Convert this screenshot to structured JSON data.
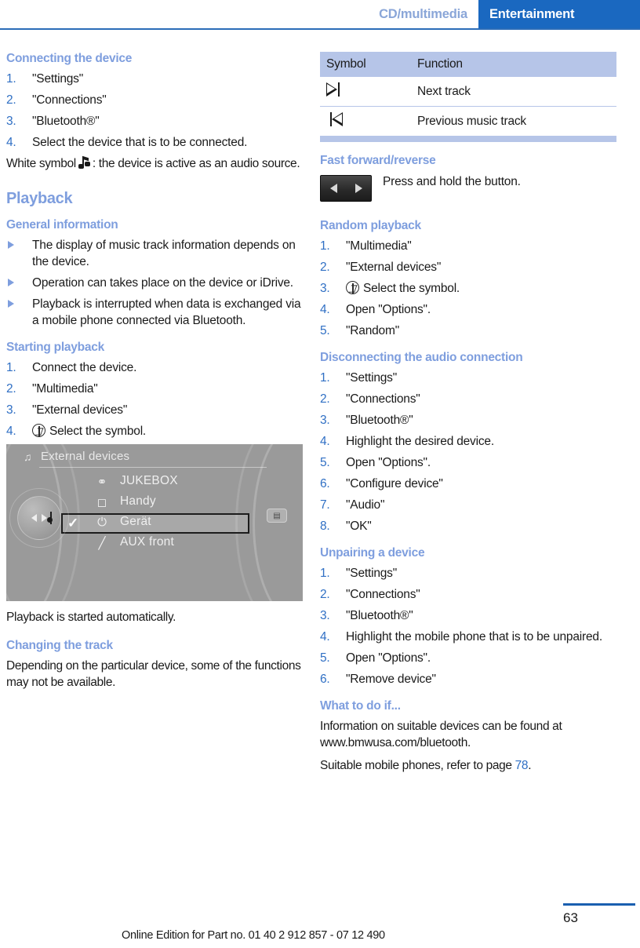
{
  "header": {
    "breadcrumb_muted": "CD/multimedia",
    "breadcrumb_active": "Entertainment"
  },
  "left_column": {
    "connecting": {
      "heading": "Connecting the device",
      "steps": [
        "\"Settings\"",
        "\"Connections\"",
        "\"Bluetooth®\"",
        "Select the device that is to be connected."
      ],
      "note_before": "White symbol",
      "note_after": ": the device is active as an audio source."
    },
    "playback": {
      "chapter": "Playback",
      "general_heading": "General information",
      "general_bullets": [
        "The display of music track information depends on the device.",
        "Operation can takes place on the device or iDrive.",
        "Playback is interrupted when data is exchanged via a mobile phone connected via Bluetooth."
      ],
      "starting_heading": "Starting playback",
      "starting_steps": [
        "Connect the device.",
        "\"Multimedia\"",
        "\"External devices\"",
        "Select the symbol."
      ],
      "after_image_text": "Playback is started automatically.",
      "changing_heading": "Changing the track",
      "changing_text": "Depending on the particular device, some of the functions may not be available."
    },
    "idrive_screenshot": {
      "title": "External devices",
      "title_icon": "multimedia-icon",
      "rows": [
        {
          "icon": "usb-icon",
          "label": "JUKEBOX",
          "checked": false
        },
        {
          "icon": "phone-icon",
          "label": "Handy",
          "checked": false
        },
        {
          "icon": "bluetooth-icon",
          "label": "Gerät",
          "checked": true
        },
        {
          "icon": "aux-icon",
          "label": "AUX front",
          "checked": false
        }
      ]
    }
  },
  "right_column": {
    "symbol_table": {
      "headers": [
        "Symbol",
        "Function"
      ],
      "rows": [
        {
          "icon": "next-track-icon",
          "function": "Next track"
        },
        {
          "icon": "previous-track-icon",
          "function": "Previous music track"
        }
      ]
    },
    "fast_forward": {
      "heading": "Fast forward/reverse",
      "button_icon": "seek-left-right-button",
      "text": "Press and hold the button."
    },
    "random": {
      "heading": "Random playback",
      "steps": [
        "\"Multimedia\"",
        "\"External devices\"",
        "Select the symbol.",
        "Open \"Options\".",
        "\"Random\""
      ]
    },
    "disconnect": {
      "heading": "Disconnecting the audio connection",
      "steps": [
        "\"Settings\"",
        "\"Connections\"",
        "\"Bluetooth®\"",
        "Highlight the desired device.",
        "Open \"Options\".",
        "\"Configure device\"",
        "\"Audio\"",
        "\"OK\""
      ]
    },
    "unpair": {
      "heading": "Unpairing a device",
      "steps": [
        "\"Settings\"",
        "\"Connections\"",
        "\"Bluetooth®\"",
        "Highlight the mobile phone that is to be unpaired.",
        "Open \"Options\".",
        "\"Remove device\""
      ]
    },
    "what_to_do": {
      "heading": "What to do if...",
      "paragraph1": "Information on suitable devices can be found at www.bmwusa.com/bluetooth.",
      "paragraph2_before": "Suitable mobile phones, refer to page ",
      "paragraph2_ref": "78",
      "paragraph2_after": "."
    }
  },
  "footer": {
    "note": "Online Edition for Part no. 01 40 2 912 857 - 07 12 490",
    "page_number": "63"
  },
  "colors": {
    "accent_blue": "#1a68c0",
    "heading_blue": "#7e9ede",
    "number_blue": "#2f6fc4",
    "table_header_bg": "#b6c5e8"
  }
}
